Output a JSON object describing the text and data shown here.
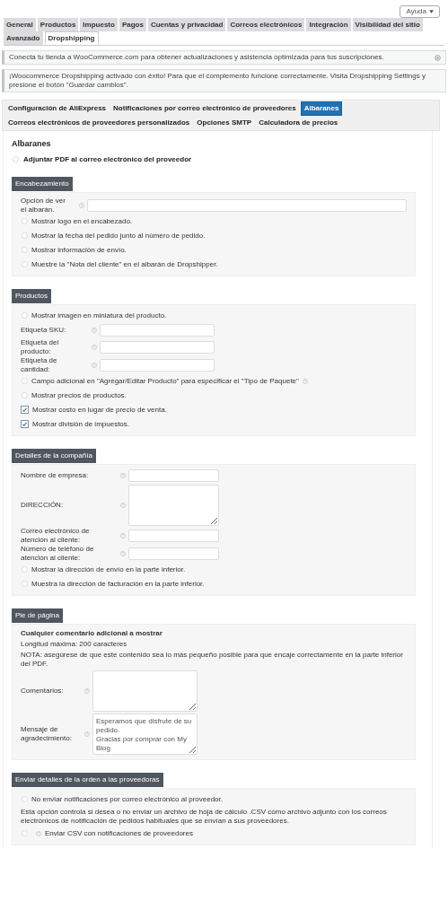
{
  "help_button": {
    "label": "Ayuda"
  },
  "settings_tabs": [
    {
      "label": "General",
      "selected": false
    },
    {
      "label": "Productos",
      "selected": false
    },
    {
      "label": "Impuesto",
      "selected": false
    },
    {
      "label": "Pagos",
      "selected": false
    },
    {
      "label": "Cuentas y privacidad",
      "selected": false
    },
    {
      "label": "Correos electrónicos",
      "selected": false
    },
    {
      "label": "Integración",
      "selected": false
    },
    {
      "label": "Visibilidad del sitio",
      "selected": false
    },
    {
      "label": "Avanzado",
      "selected": false
    },
    {
      "label": "Dropshipping",
      "selected": true
    }
  ],
  "notices": [
    {
      "text": "Conecta tu tienda a WooCommerce.com para obtener actualizaciones y asistencia optimizada para tus suscripciones.",
      "dismissible": true
    },
    {
      "text": "¡Woocommerce Dropshipping activado con éxito! Para que el complemento funcione correctamente. Visita Dropshipping Settings y presione el botón \"Guardar cambios\".",
      "dismissible": false
    }
  ],
  "plugin_tabs": [
    {
      "label": "Configuración de AliExpress",
      "selected": false
    },
    {
      "label": "Notificaciones por correo electrónico de proveedores",
      "selected": false
    },
    {
      "label": "Albaranes",
      "selected": true
    },
    {
      "label": "Correos electrónicos de proveedores personalizados",
      "selected": false
    },
    {
      "label": "Opciones SMTP",
      "selected": false
    },
    {
      "label": "Calculadora de precios",
      "selected": false
    }
  ],
  "page_title": "Albaranes",
  "attach_pdf": {
    "label": "Adjuntar PDF al correo electrónico del proveedor",
    "checked": false
  },
  "sections": [
    {
      "title": "Encabezamiento",
      "items": [
        {
          "kind": "field",
          "label": "Opción de ver el albarán."
        },
        {
          "kind": "checkbox",
          "label": "Mostrar logo en el encabezado.",
          "checked": false
        },
        {
          "kind": "checkbox",
          "label": "Mostrar la fecha del pedido junto al número de pedido.",
          "checked": false
        },
        {
          "kind": "checkbox",
          "label": "Mostrar información de envío.",
          "checked": false
        },
        {
          "kind": "checkbox",
          "label": "Muestre la \"Nota del cliente\" en el albarán de Dropshipper.",
          "checked": false
        }
      ]
    },
    {
      "title": "Productos",
      "items": [
        {
          "kind": "checkbox",
          "label": "Mostrar imagen en miniatura del producto.",
          "checked": false
        },
        {
          "kind": "field",
          "label": "Etiqueta SKU:"
        },
        {
          "kind": "field",
          "label": "Etiqueta del producto:"
        },
        {
          "kind": "field",
          "label": "Etiqueta de cantidad:"
        },
        {
          "kind": "hintcheckbox",
          "label": "Campo adicional en \"Agregar/Editar Producto\" para especificar el \"Tipo de Paquete\"",
          "checked": false
        },
        {
          "kind": "checkbox",
          "label": "Mostrar precios de productos.",
          "checked": false
        },
        {
          "kind": "checkbox",
          "label": "Mostrar costo en lugar de precio de venta.",
          "checked": true
        },
        {
          "kind": "checkbox",
          "label": "Mostrar división de impuestos.",
          "checked": true
        }
      ]
    },
    {
      "title": "Detalles de la compañía",
      "items": [
        {
          "kind": "field",
          "label": "Nombre de empresa:"
        },
        {
          "kind": "textarea",
          "label": "DIRECCIÓN:"
        },
        {
          "kind": "field",
          "label": "Correo electrónico de atención al cliente:"
        },
        {
          "kind": "field",
          "label": "Número de teléfono de atención al cliente:"
        },
        {
          "kind": "checkbox",
          "label": "Mostrar la dirección de envío en la parte inferior.",
          "checked": false
        },
        {
          "kind": "checkbox",
          "label": "Muestra la dirección de facturación en la parte inferior.",
          "checked": false
        }
      ]
    },
    {
      "title": "Pie de página",
      "items": [
        {
          "kind": "note",
          "text": "Cualquier comentario adicional a mostrar",
          "bold": true
        },
        {
          "kind": "note",
          "text": "Longitud máxima: 200 caracteres",
          "bold": false
        },
        {
          "kind": "note",
          "text": "NOTA: asegúrese de que este contenido sea lo más pequeño posible para que encaje correctamente en la parte inferior del PDF.",
          "bold": false
        },
        {
          "kind": "textarea",
          "label": "Comentarios:"
        },
        {
          "kind": "textarea",
          "label": "Mensaje de agradecimiento:",
          "value": "Esperamos que disfrute de su pedido.\nGracias por comprar con My Blog"
        }
      ]
    },
    {
      "title": "Enviar detalles de la orden a las proveedoras",
      "items": [
        {
          "kind": "checkbox",
          "label": "No enviar notificaciones por correo electrónico al proveedor.",
          "checked": false
        },
        {
          "kind": "note",
          "text": "Esta opción controla si desea o no enviar un archivo de hoja de cálculo .CSV como archivo adjunto con los correos electrónicos de notificación de pedidos habituales que se envían a sus proveedores.",
          "bold": false
        },
        {
          "kind": "helpcheckbox",
          "label": "Enviar CSV con notificaciones de proveedores",
          "checked": false
        }
      ]
    }
  ]
}
